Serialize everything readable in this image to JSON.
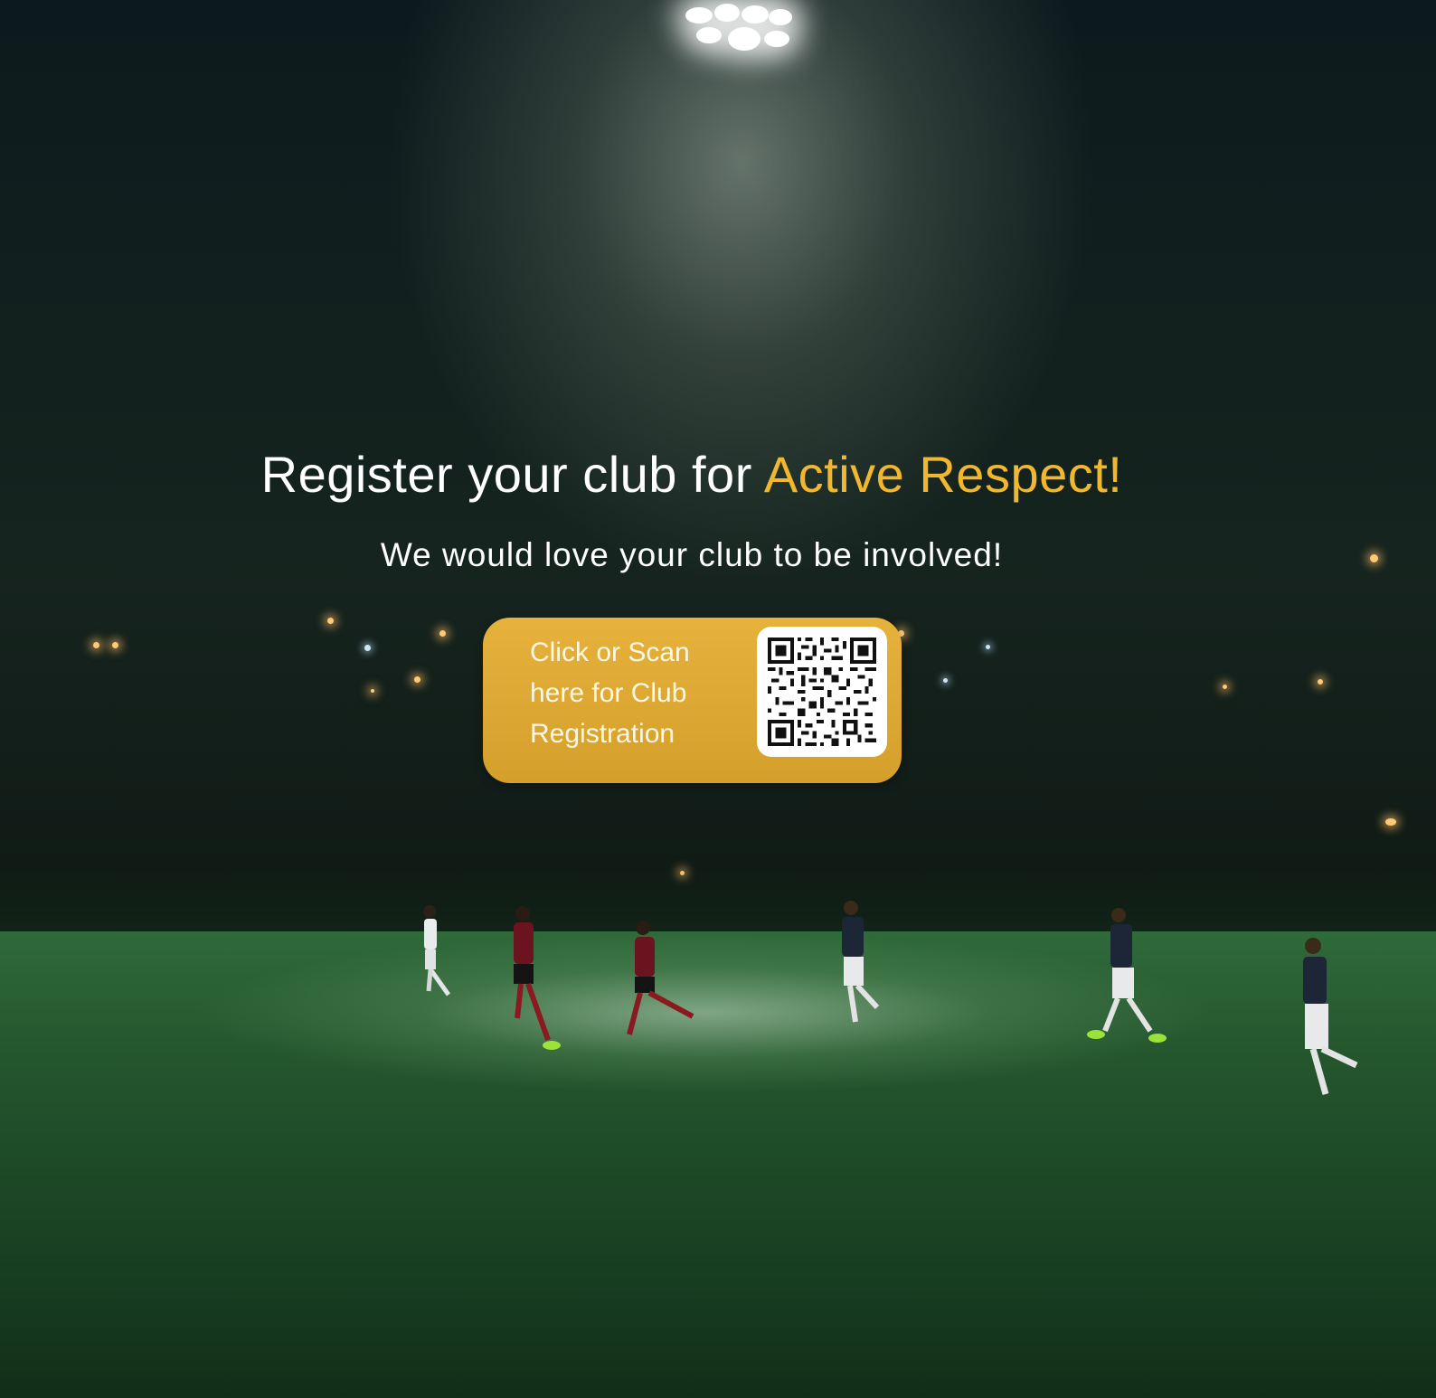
{
  "headline": {
    "prefix": "Register your club for ",
    "highlight": "Active Respect!"
  },
  "subheadline": "We would love your club to be involved!",
  "cta": {
    "line1": "Click or Scan",
    "line2": "here for Club",
    "line3": "Registration"
  },
  "colors": {
    "accent": "#f1b72e",
    "button": "#dca833",
    "text": "#ffffff"
  }
}
